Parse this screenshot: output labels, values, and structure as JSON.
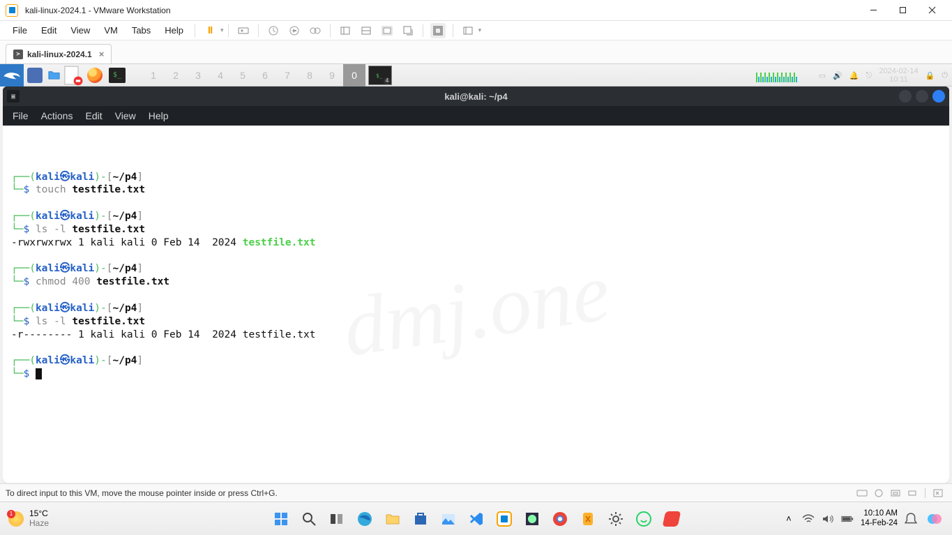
{
  "win_title": "kali-linux-2024.1 - VMware Workstation",
  "vm_menu": [
    "File",
    "Edit",
    "View",
    "VM",
    "Tabs",
    "Help"
  ],
  "vm_tab_label": "kali-linux-2024.1",
  "kali_workspaces": [
    "1",
    "2",
    "3",
    "4",
    "5",
    "6",
    "7",
    "8",
    "9",
    "0"
  ],
  "kali_active_ws": "0",
  "kali_date": "2024-02-14",
  "kali_time": "10:11",
  "term_title": "kali@kali: ~/p4",
  "term_menu": [
    "File",
    "Actions",
    "Edit",
    "View",
    "Help"
  ],
  "watermark": "dmj.one",
  "prompt": {
    "user": "kali",
    "host": "kali",
    "path": "~/p4"
  },
  "blocks": [
    {
      "cmd": "touch",
      "flags": "",
      "arg": "testfile.txt",
      "output": []
    },
    {
      "cmd": "ls",
      "flags": "-l",
      "arg": "testfile.txt",
      "output": [
        {
          "text": "-rwxrwxrwx 1 kali kali 0 Feb 14  2024 ",
          "green": "testfile.txt"
        }
      ]
    },
    {
      "cmd": "chmod",
      "flags": "400",
      "arg": "testfile.txt",
      "output": []
    },
    {
      "cmd": "ls",
      "flags": "-l",
      "arg": "testfile.txt",
      "output": [
        {
          "text": "-r-------- 1 kali kali 0 Feb 14  2024 testfile.txt",
          "green": ""
        }
      ]
    }
  ],
  "vm_status_text": "To direct input to this VM, move the mouse pointer inside or press Ctrl+G.",
  "win_weather_temp": "15°C",
  "win_weather_desc": "Haze",
  "win_weather_badge": "1",
  "win_clock_time": "10:10 AM",
  "win_clock_date": "14-Feb-24"
}
